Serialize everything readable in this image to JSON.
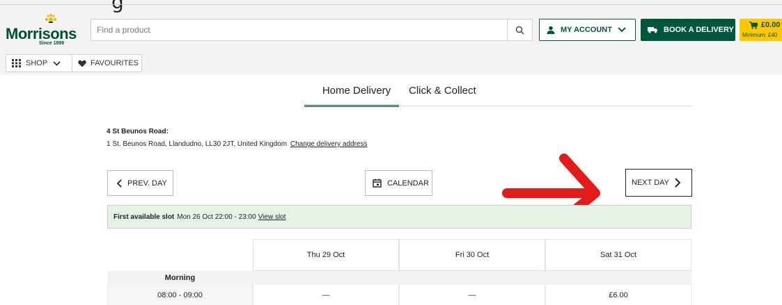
{
  "header": {
    "brand": "Morrisons",
    "since": "Since 1899",
    "search_placeholder": "Find a product",
    "account_label": "MY ACCOUNT",
    "book_label": "BOOK A DELIVERY",
    "basket_total": "£0.00",
    "basket_minimum": "Minimum: £40"
  },
  "nav": {
    "shop_label": "SHOP",
    "favourites_label": "FAVOURITES"
  },
  "tabs": [
    {
      "label": "Home Delivery",
      "active": true
    },
    {
      "label": "Click & Collect",
      "active": false
    }
  ],
  "address": {
    "title": "4 St Beunos Road:",
    "line": "1 St. Beunos Road, Llandudno, LL30 2JT, United Kingdom",
    "change_link": "Change delivery address"
  },
  "controls": {
    "prev_label": "PREV. DAY",
    "calendar_label": "CALENDAR",
    "next_label": "NEXT DAY"
  },
  "first_slot": {
    "label": "First available slot",
    "value": "Mon 26 Oct 22:00 - 23:00",
    "link": "View slot"
  },
  "grid": {
    "days": [
      "Thu 29 Oct",
      "Fri 30 Oct",
      "Sat 31 Oct"
    ],
    "period": "Morning",
    "rows": [
      {
        "time": "08:00 - 09:00",
        "cells": [
          "—",
          "—",
          "£6.00"
        ]
      }
    ]
  },
  "colors": {
    "brand_green": "#00563f",
    "basket_yellow": "#ffc700",
    "annotation_red": "#e21b1b"
  }
}
